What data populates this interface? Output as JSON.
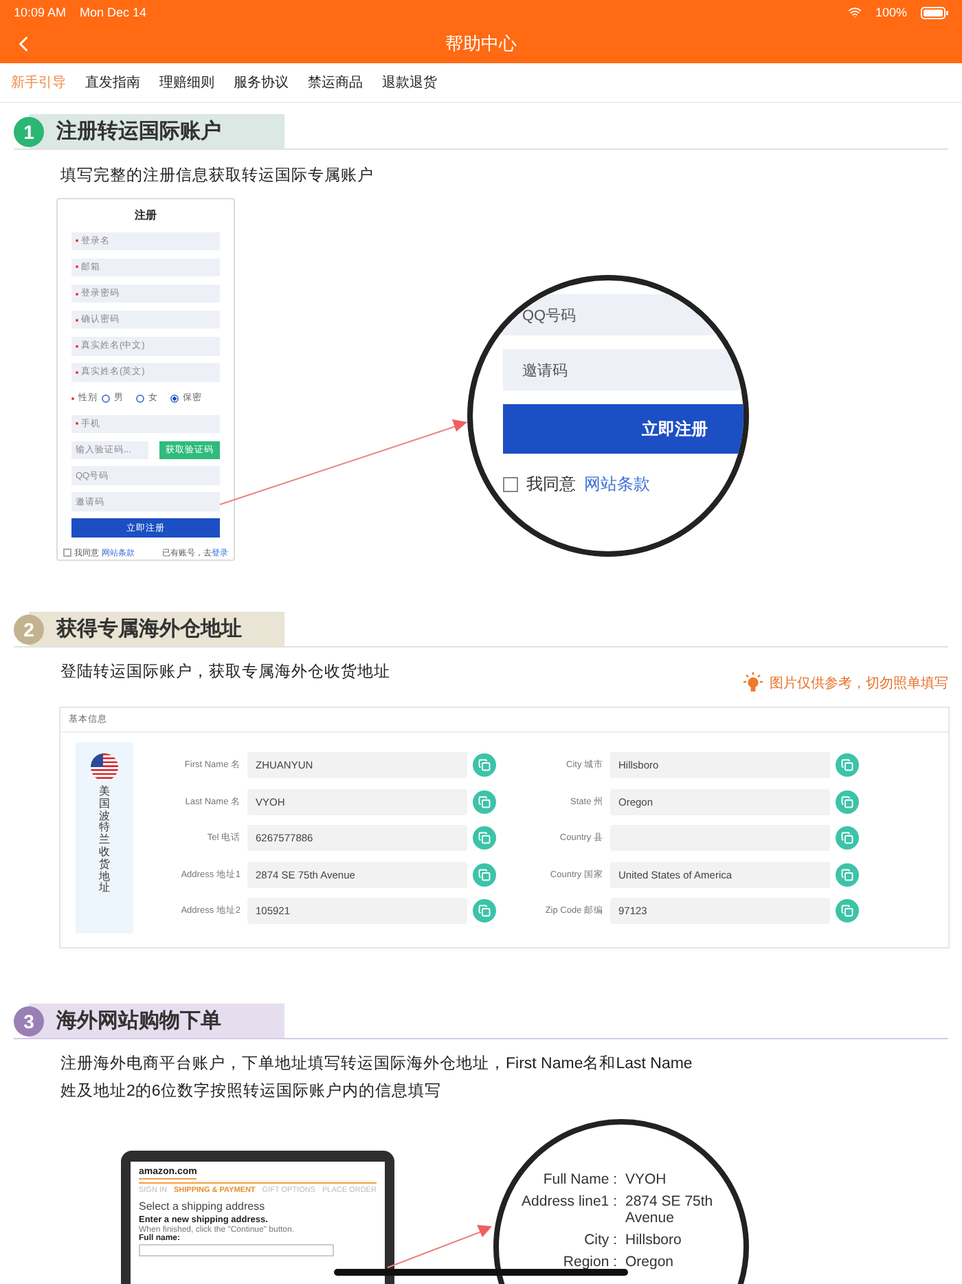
{
  "status_bar": {
    "time": "10:09 AM",
    "date": "Mon Dec 14",
    "battery": "100%"
  },
  "nav": {
    "title": "帮助中心"
  },
  "tabs": [
    {
      "label": "新手引导",
      "selected": true
    },
    {
      "label": "直发指南",
      "selected": false
    },
    {
      "label": "理赔细则",
      "selected": false
    },
    {
      "label": "服务协议",
      "selected": false
    },
    {
      "label": "禁运商品",
      "selected": false
    },
    {
      "label": "退款退货",
      "selected": false
    }
  ],
  "step1": {
    "number": "1",
    "title": "注册转运国际账户",
    "subtitle": "填写完整的注册信息获取转运国际专属账户",
    "form": {
      "title": "注册",
      "rows": [
        {
          "kind": "field",
          "label": "登录名",
          "required": true
        },
        {
          "kind": "field",
          "label": "邮箱",
          "required": true
        },
        {
          "kind": "field",
          "label": "登录密码",
          "required": true
        },
        {
          "kind": "field",
          "label": "确认密码",
          "required": true
        },
        {
          "kind": "field",
          "label": "真实姓名(中文)",
          "required": true
        },
        {
          "kind": "field",
          "label": "真实姓名(英文)",
          "required": true
        },
        {
          "kind": "radio",
          "label": "性别",
          "required": true,
          "options": [
            {
              "label": "男",
              "selected": false
            },
            {
              "label": "女",
              "selected": false
            },
            {
              "label": "保密",
              "selected": true
            }
          ]
        },
        {
          "kind": "field",
          "label": "手机",
          "required": true
        },
        {
          "kind": "code",
          "label": "输入验证码...",
          "button": "获取验证码"
        },
        {
          "kind": "field",
          "label": "QQ号码",
          "required": false
        },
        {
          "kind": "field",
          "label": "邀请码",
          "required": false
        },
        {
          "kind": "submit",
          "label": "立即注册"
        }
      ],
      "agree": {
        "checked": false,
        "label": "我同意",
        "link": "网站条款"
      },
      "login": {
        "text": "已有账号，去",
        "link": "登录"
      }
    },
    "zoom": {
      "fields": [
        "QQ号码",
        "邀请码"
      ],
      "submit": "立即注册",
      "checked": false,
      "agree": "我同意",
      "link": "网站条款"
    }
  },
  "step2": {
    "number": "2",
    "title": "获得专属海外仓地址",
    "subtitle": "登陆转运国际账户，获取专属海外仓收货地址",
    "tip": "图片仅供参考，切勿照单填写",
    "card": {
      "title": "基本信息",
      "region": "美国波特兰收货地址",
      "left": [
        {
          "label": "First Name 名",
          "value": "ZHUANYUN"
        },
        {
          "label": "Last Name 名",
          "value": "VYOH"
        },
        {
          "label": "Tel 电话",
          "value": "6267577886"
        },
        {
          "label": "Address 地址1",
          "value": "2874 SE 75th Avenue"
        },
        {
          "label": "Address 地址2",
          "value": "105921"
        }
      ],
      "right": [
        {
          "label": "City 城市",
          "value": "Hillsboro"
        },
        {
          "label": "State 州",
          "value": "Oregon"
        },
        {
          "label": "Country 县"
        },
        {
          "label": "Country 国家",
          "value": "United States of America"
        },
        {
          "label": "Zip Code 邮编",
          "value": "97123"
        }
      ]
    }
  },
  "step3": {
    "number": "3",
    "title": "海外网站购物下单",
    "text": "注册海外电商平台账户，下单地址填写转运国际海外仓地址，First Name名和Last Name姓及地址2的6位数字按照转运国际账户内的信息填写",
    "laptop": {
      "logo": "amazon.com",
      "steps": [
        {
          "label": "SIGN IN",
          "selected": false
        },
        {
          "label": "SHIPPING & PAYMENT",
          "selected": true
        },
        {
          "label": "GIFT OPTIONS",
          "selected": false
        },
        {
          "label": "PLACE ORDER",
          "selected": false
        }
      ],
      "heading": "Select a shipping address",
      "subheading": "Enter a new shipping address.",
      "hint": "When finished, click the \"Continue\" button.",
      "field_label": "Full name:"
    },
    "zoom": [
      {
        "label": "Full Name :",
        "value": "VYOH"
      },
      {
        "label": "Address line1 :",
        "value": "2874 SE 75th Avenue"
      },
      {
        "label": "City :",
        "value": "Hillsboro"
      },
      {
        "label": "Region :",
        "value": "Oregon"
      }
    ]
  }
}
